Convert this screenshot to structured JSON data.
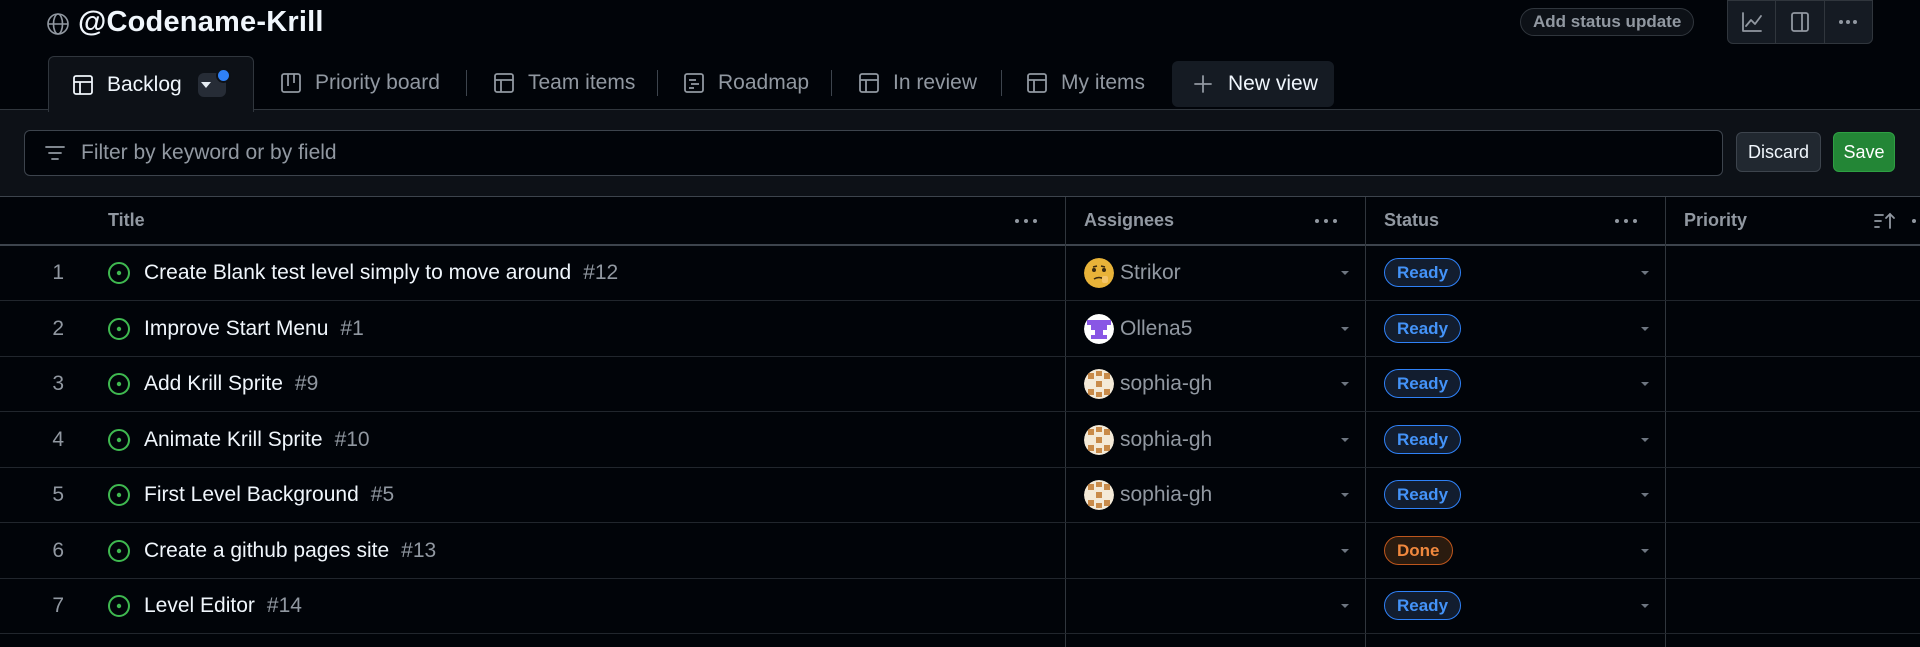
{
  "header": {
    "title": "@Codename-Krill",
    "status_update_label": "Add status update",
    "icons": [
      "insights-icon",
      "sidebar-icon",
      "more-icon"
    ]
  },
  "tabs": [
    {
      "label": "Backlog",
      "icon": "table-icon",
      "active": true
    },
    {
      "label": "Priority board",
      "icon": "board-icon"
    },
    {
      "label": "Team items",
      "icon": "table-icon"
    },
    {
      "label": "Roadmap",
      "icon": "roadmap-icon"
    },
    {
      "label": "In review",
      "icon": "table-icon"
    },
    {
      "label": "My items",
      "icon": "table-icon"
    }
  ],
  "new_view_label": "New view",
  "filter": {
    "placeholder": "Filter by keyword or by field"
  },
  "actions": {
    "discard_label": "Discard",
    "save_label": "Save"
  },
  "columns": {
    "title": "Title",
    "assignees": "Assignees",
    "status": "Status",
    "priority": "Priority"
  },
  "colors": {
    "ready": "#4493f8",
    "done": "#f0883e",
    "open_issue": "#3fb950",
    "save": "#238636"
  },
  "rows": [
    {
      "index": "1",
      "title": "Create Blank test level simply to move around",
      "number": "#12",
      "assignee": "Strikor",
      "avatar": "strikor",
      "status": "Ready"
    },
    {
      "index": "2",
      "title": "Improve Start Menu",
      "number": "#1",
      "assignee": "Ollena5",
      "avatar": "ollena",
      "status": "Ready"
    },
    {
      "index": "3",
      "title": "Add Krill Sprite",
      "number": "#9",
      "assignee": "sophia-gh",
      "avatar": "sophia",
      "status": "Ready"
    },
    {
      "index": "4",
      "title": "Animate Krill Sprite",
      "number": "#10",
      "assignee": "sophia-gh",
      "avatar": "sophia",
      "status": "Ready"
    },
    {
      "index": "5",
      "title": "First Level Background",
      "number": "#5",
      "assignee": "sophia-gh",
      "avatar": "sophia",
      "status": "Ready"
    },
    {
      "index": "6",
      "title": "Create a github pages site",
      "number": "#13",
      "assignee": "",
      "avatar": "",
      "status": "Done"
    },
    {
      "index": "7",
      "title": "Level Editor",
      "number": "#14",
      "assignee": "",
      "avatar": "",
      "status": "Ready"
    }
  ]
}
